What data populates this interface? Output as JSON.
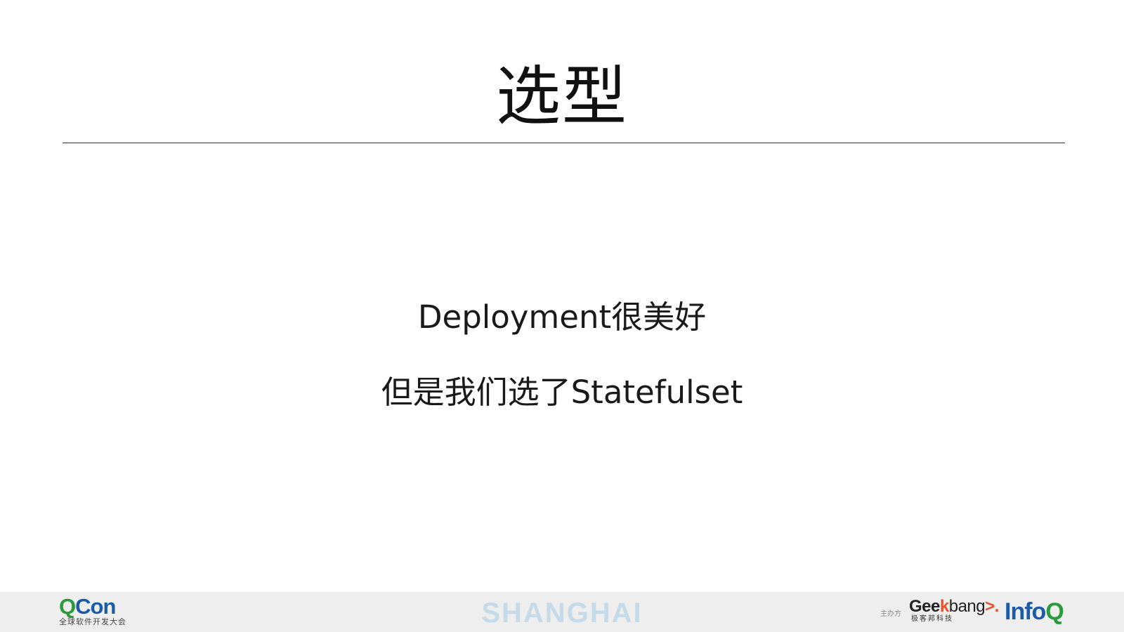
{
  "slide": {
    "title": "选型",
    "lines": [
      "Deployment很美好",
      "但是我们选了Statefulset"
    ]
  },
  "footer": {
    "qcon": {
      "brand_q": "Q",
      "brand_rest": "Con",
      "tagline": "全球软件开发大会"
    },
    "city": "SHANGHAI",
    "sponsor_label": "主办方",
    "geekbang": {
      "part_geek": "Gee",
      "part_k": "k",
      "part_bang": "bang",
      "arrow": ">.",
      "tagline": "极客邦科技"
    },
    "infoq": {
      "part_info": "Info",
      "part_q": "Q"
    }
  },
  "colors": {
    "footer_bg": "#eeeeee",
    "qcon_green": "#2a9a3c",
    "qcon_blue": "#1d5aa8",
    "city_text": "#c5dbe9",
    "geekbang_orange": "#e5532d"
  }
}
